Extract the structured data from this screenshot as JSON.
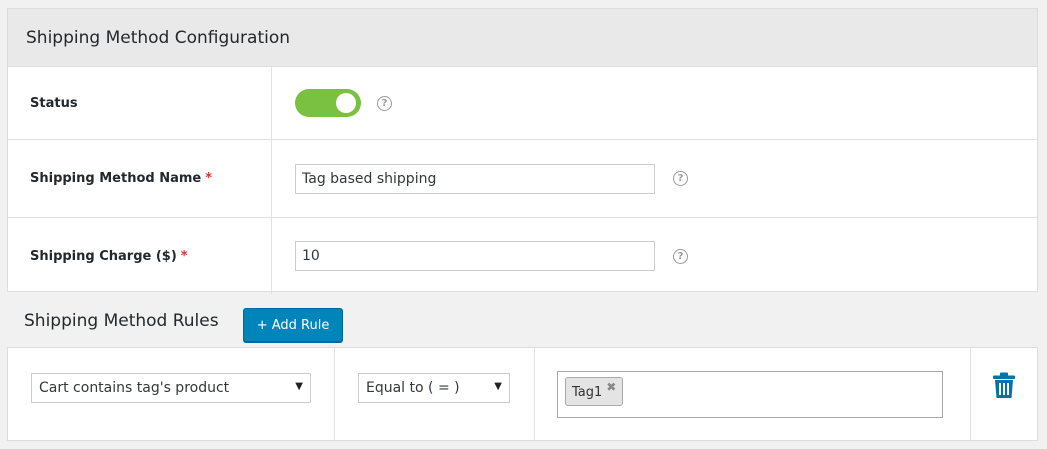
{
  "config": {
    "title": "Shipping Method Configuration",
    "status": {
      "label": "Status",
      "enabled": true,
      "toggle_color": "#7ac142"
    },
    "name": {
      "label": "Shipping Method Name",
      "required_mark": "*",
      "value": "Tag based shipping"
    },
    "charge": {
      "label": "Shipping Charge ($)",
      "required_mark": "*",
      "value": "10"
    },
    "help_glyph": "?"
  },
  "rules": {
    "title": "Shipping Method Rules",
    "add_button": "+ Add Rule",
    "accent": "#0085ba",
    "items": [
      {
        "condition": "Cart contains tag's product",
        "operator": "Equal to ( = )",
        "tags": [
          "Tag1"
        ],
        "tag_remove_glyph": "✖",
        "delete_icon": "trash-icon"
      }
    ]
  }
}
